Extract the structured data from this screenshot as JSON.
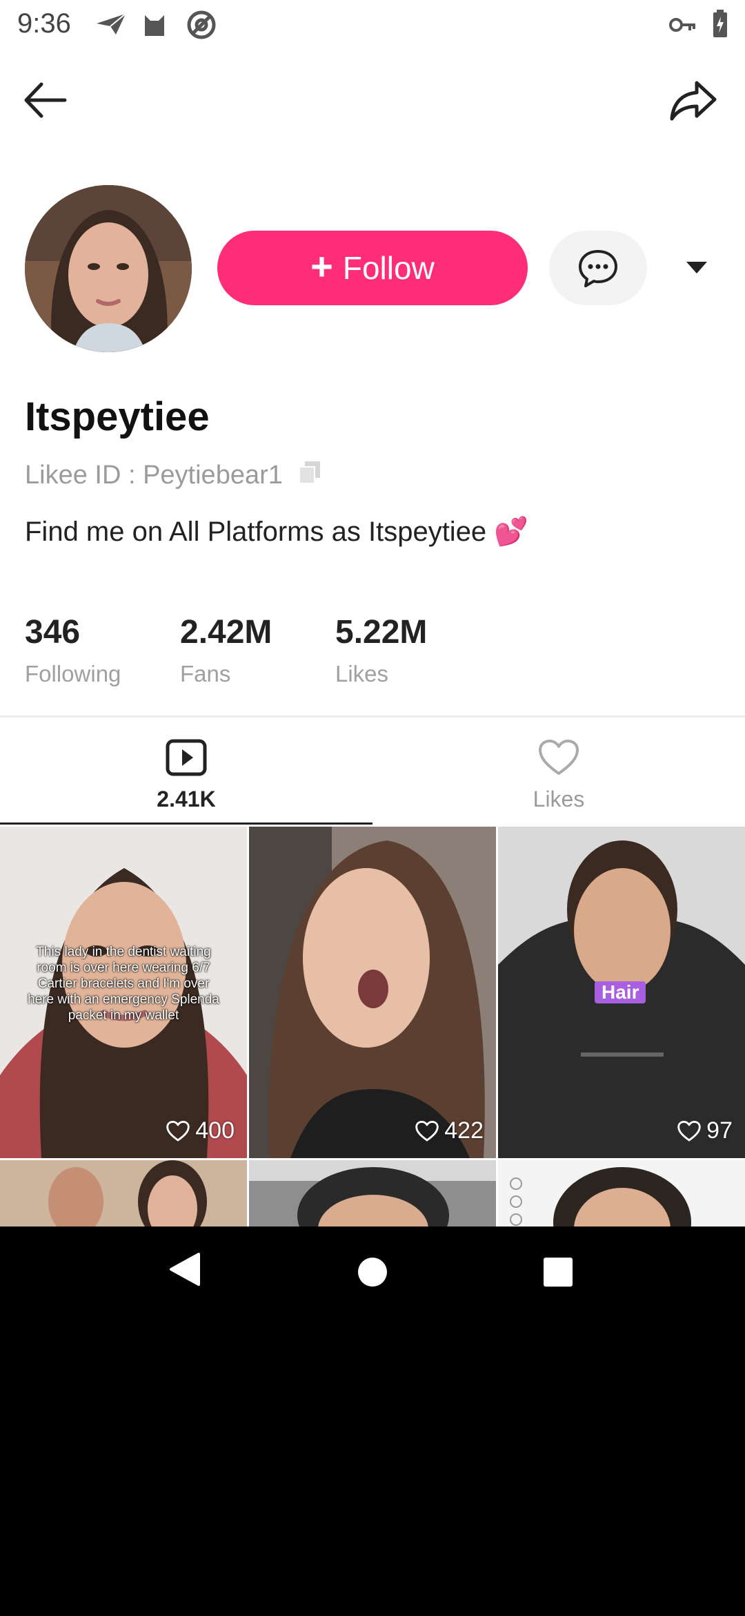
{
  "status_bar": {
    "time": "9:36",
    "icons": [
      "send-icon",
      "cat-icon",
      "at-icon",
      "key-icon",
      "battery-charging-icon"
    ]
  },
  "top_nav": {
    "back_icon": "arrow-left-icon",
    "share_icon": "share-icon"
  },
  "profile": {
    "username": "Itspeytiee",
    "likee_id": "Likee ID : Peytiebear1",
    "bio": "Find me on All Platforms as Itspeytiee 💕",
    "follow_label": "Follow",
    "accent": "#ff2d77"
  },
  "stats": [
    {
      "value": "346",
      "label": "Following"
    },
    {
      "value": "2.42M",
      "label": "Fans"
    },
    {
      "value": "5.22M",
      "label": "Likes"
    }
  ],
  "tabs": [
    {
      "label": "2.41K",
      "icon": "play-icon",
      "active": true
    },
    {
      "label": "Likes",
      "icon": "heart-icon",
      "active": false
    }
  ],
  "videos": [
    {
      "caption": "This lady in the dentist waiting room is over here wearing 6/7 Cartier bracelets and I'm over here with an emergency Splenda packet in my wallet",
      "likes": "400"
    },
    {
      "caption": "",
      "likes": "422"
    },
    {
      "tag": "Hair",
      "likes": "97"
    }
  ]
}
